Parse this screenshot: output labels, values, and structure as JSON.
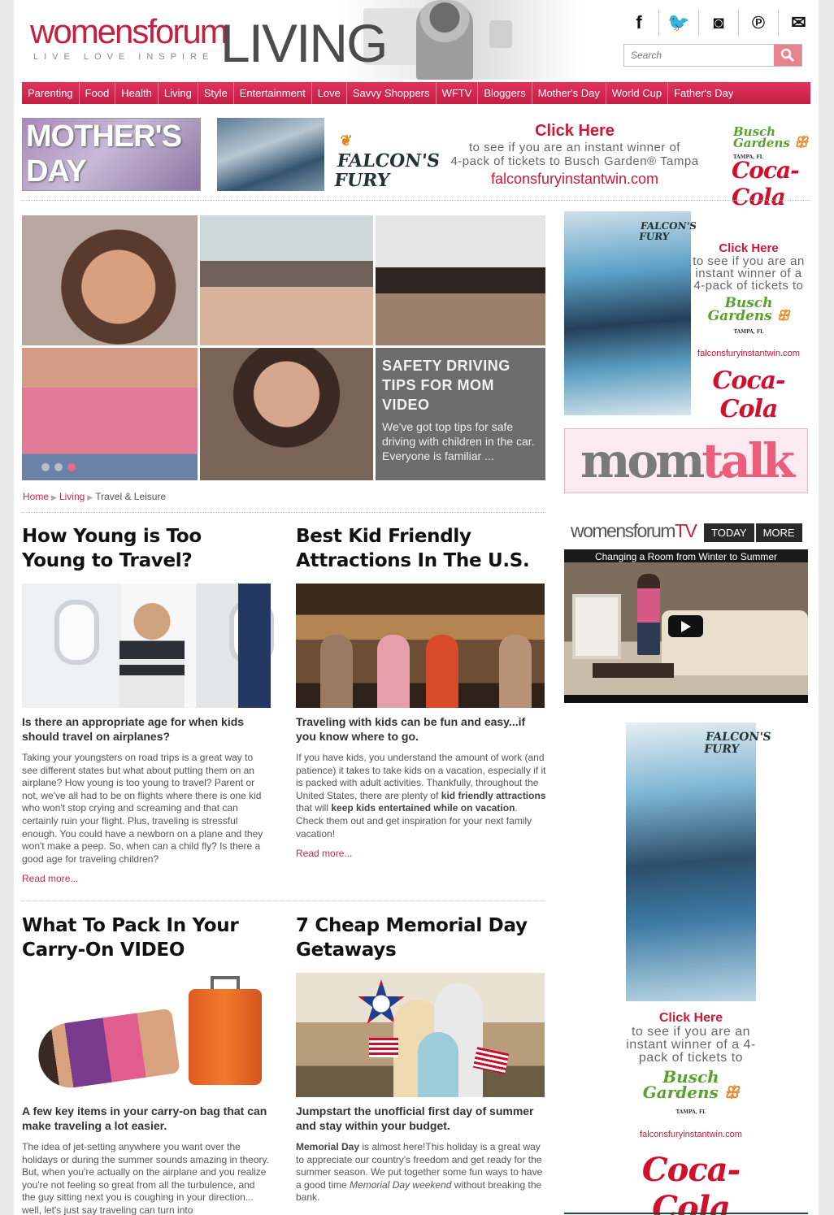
{
  "header": {
    "logo_main": "womensforum",
    "logo_tagline": "LIVE  LOVE  INSPIRE",
    "section_title": "LIVING",
    "social_icons": [
      {
        "name": "facebook-icon",
        "glyph": "f"
      },
      {
        "name": "twitter-icon",
        "glyph": "🐦"
      },
      {
        "name": "instagram-icon",
        "glyph": "◙"
      },
      {
        "name": "pinterest-icon",
        "glyph": "℗"
      },
      {
        "name": "email-icon",
        "glyph": "✉"
      }
    ],
    "search_placeholder": "Search"
  },
  "nav": {
    "items": [
      "Parenting",
      "Food",
      "Health",
      "Living",
      "Style",
      "Entertainment",
      "Love",
      "Savvy Shoppers",
      "WFTV",
      "Bloggers",
      "Mother's Day",
      "World Cup",
      "Father's Day"
    ]
  },
  "ad_strip": {
    "mothers_day": "MOTHER'S DAY",
    "ff_logo_line1": "FALCON'S",
    "ff_logo_line2": "FURY",
    "click_here": "Click Here",
    "line1": "to see if you are an instant winner of",
    "line2": "4-pack of tickets to Busch Garden® Tampa",
    "url": "falconsfuryinstantwin.com",
    "busch_line1": "Busch",
    "busch_line2": "Gardens",
    "busch_loc": "TAMPA, FL",
    "coke": "Coca-Cola"
  },
  "hero": {
    "title": "SAFETY DRIVING TIPS FOR MOM VIDEO",
    "description": "We've got top tips for safe driving with children in the car. Everyone is familiar ...",
    "dots": 3,
    "active_dot": 3
  },
  "breadcrumb": {
    "home": "Home",
    "living": "Living",
    "current": "Travel & Leisure"
  },
  "articles": [
    {
      "title": "How Young is Too Young to Travel?",
      "subtitle": "Is there an appropriate age for when kids should travel on airplanes?",
      "body": "Taking your youngsters on road trips is a great way to see different states but what about putting them on an airplane? How young is too young to travel? Parent or not, we've all had to be on flights where there is one kid who won't stop crying and screaming and that can certainly ruin your flight. Plus, traveling is stressful enough. You could have a newborn on a plane and they won't make a peep. So, when can a child fly? Is there a good age for traveling children?",
      "read_more": "Read more..."
    },
    {
      "title": "Best Kid Friendly Attractions In The U.S.",
      "subtitle": "Traveling with kids can be fun and easy...if you know where to go.",
      "body_a": "If you have kids, you understand the amount of work (and patience) it takes to take kids on a vacation, especially if it is packed with adult activities. Thankfully, throughout the United States, there are plenty of ",
      "body_b1": "kid friendly attractions",
      "body_c": " that will ",
      "body_b2": "keep kids entertained while on vacation",
      "body_d": ". Check them out and get inspiration for your next family vacation!",
      "read_more": "Read more..."
    },
    {
      "title": "What To Pack In Your Carry-On VIDEO",
      "subtitle": "A few key items in your carry-on bag that can make traveling a lot easier.",
      "body": "The idea of jet-setting anywhere you want over the holidays or during the summer sounds amazing in theory. But, when you're actually on the airplane and you realize you're not feeling so great from all the turbulence, and the guy sitting next you is coughing in your direction... well, let's just say traveling can turn into"
    },
    {
      "title": "7 Cheap Memorial Day Getaways",
      "subtitle": "Jumpstart the unofficial first day of summer and stay within your budget.",
      "body_b": "Memorial Day",
      "body_a": " is almost here!This holiday is a great way to appreciate our country's freedom and get ready for the summer season. We put together some fun ways to have a good time ",
      "body_i": "Memorial Day weekend",
      "body_c": " without breaking the bank."
    }
  ],
  "sidebar": {
    "ad1": {
      "click_here": "Click Here",
      "copy": "to see if you are an instant winner of a 4-pack of tickets to",
      "busch_line1": "Busch",
      "busch_line2": "Gardens",
      "busch_loc": "TAMPA, FL",
      "url": "falconsfuryinstantwin.com",
      "coke": "Coca-Cola",
      "ff_line1": "FALCON'S",
      "ff_line2": "FURY"
    },
    "momtalk_mom": "mom",
    "momtalk_talk": "talk",
    "wftv": {
      "logo_a": "womensforum",
      "logo_b": "TV",
      "tab_today": "TODAY",
      "tab_more": "MORE",
      "video_title": "Changing a Room from Winter to Summer"
    },
    "ad2": {
      "click_here": "Click Here",
      "copy": "to see if you are an instant winner of a 4-pack of tickets to",
      "busch_line1": "Busch",
      "busch_line2": "Gardens",
      "busch_loc": "TAMPA, FL",
      "url": "falconsfuryinstantwin.com",
      "coke": "Coca-Cola",
      "ff_line1": "FALCON'S",
      "ff_line2": "FURY"
    }
  },
  "colors": {
    "brand_red": "#c5203f",
    "nav_red": "#d62a50",
    "link_red": "#c8284c",
    "busch_green": "#5aa02f"
  }
}
